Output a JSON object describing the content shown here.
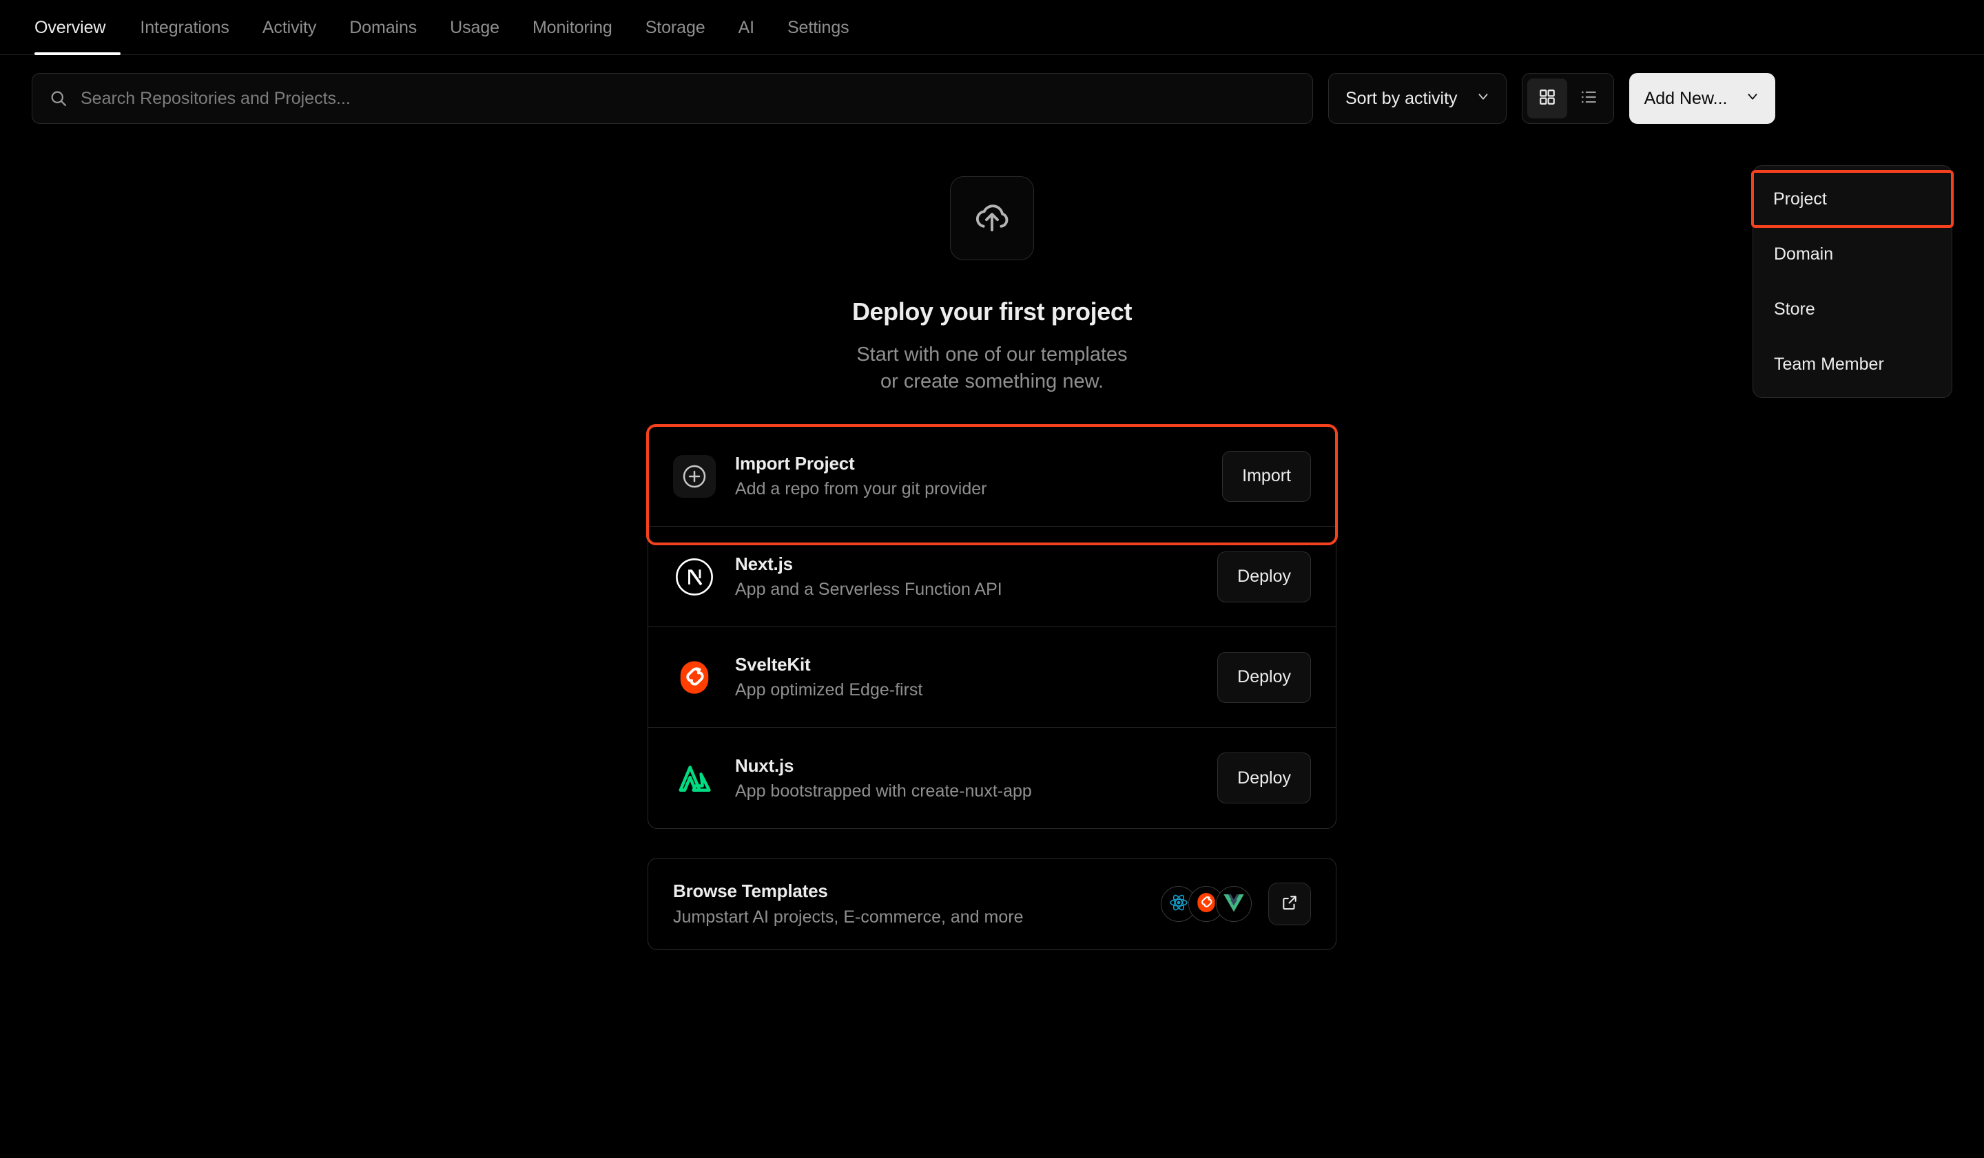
{
  "nav": {
    "tabs": [
      {
        "label": "Overview",
        "active": true
      },
      {
        "label": "Integrations",
        "active": false
      },
      {
        "label": "Activity",
        "active": false
      },
      {
        "label": "Domains",
        "active": false
      },
      {
        "label": "Usage",
        "active": false
      },
      {
        "label": "Monitoring",
        "active": false
      },
      {
        "label": "Storage",
        "active": false
      },
      {
        "label": "AI",
        "active": false
      },
      {
        "label": "Settings",
        "active": false
      }
    ]
  },
  "toolbar": {
    "search_placeholder": "Search Repositories and Projects...",
    "search_value": "",
    "search_icon": "search-icon",
    "sort_label": "Sort by activity",
    "sort_caret_icon": "chevron-down-icon",
    "grid_view_icon": "grid-view-icon",
    "list_view_icon": "list-view-icon",
    "add_new_label": "Add New...",
    "add_new_caret_icon": "chevron-down-icon"
  },
  "dropdown": {
    "items": [
      {
        "label": "Project",
        "highlighted": true
      },
      {
        "label": "Domain",
        "highlighted": false
      },
      {
        "label": "Store",
        "highlighted": false
      },
      {
        "label": "Team Member",
        "highlighted": false
      }
    ]
  },
  "hero": {
    "icon": "cloud-upload-icon",
    "title": "Deploy your first project",
    "subtitle_line1": "Start with one of our templates",
    "subtitle_line2": "or create something new."
  },
  "templates": {
    "rows": [
      {
        "icon": "plus-circle-icon",
        "title": "Import Project",
        "description": "Add a repo from your git provider",
        "button": "Import",
        "highlighted": true
      },
      {
        "icon": "nextjs-logo-icon",
        "title": "Next.js",
        "description": "App and a Serverless Function API",
        "button": "Deploy",
        "highlighted": false
      },
      {
        "icon": "sveltekit-logo-icon",
        "title": "SvelteKit",
        "description": "App optimized Edge-first",
        "button": "Deploy",
        "highlighted": false
      },
      {
        "icon": "nuxtjs-logo-icon",
        "title": "Nuxt.js",
        "description": "App bootstrapped with create-nuxt-app",
        "button": "Deploy",
        "highlighted": false
      }
    ]
  },
  "browse": {
    "title": "Browse Templates",
    "description": "Jumpstart AI projects, E-commerce, and more",
    "avatars": [
      "react-logo-icon",
      "svelte-logo-icon",
      "vue-logo-icon"
    ],
    "external_link_icon": "external-link-icon"
  },
  "colors": {
    "highlight": "#f6411e",
    "accent_light": "#ededed",
    "background": "#000000",
    "muted_text": "#8f8f8f",
    "svelte_orange": "#ff3e00",
    "nuxt_green": "#00dc82",
    "react_blue": "#149eca",
    "vue_green": "#41b883"
  }
}
